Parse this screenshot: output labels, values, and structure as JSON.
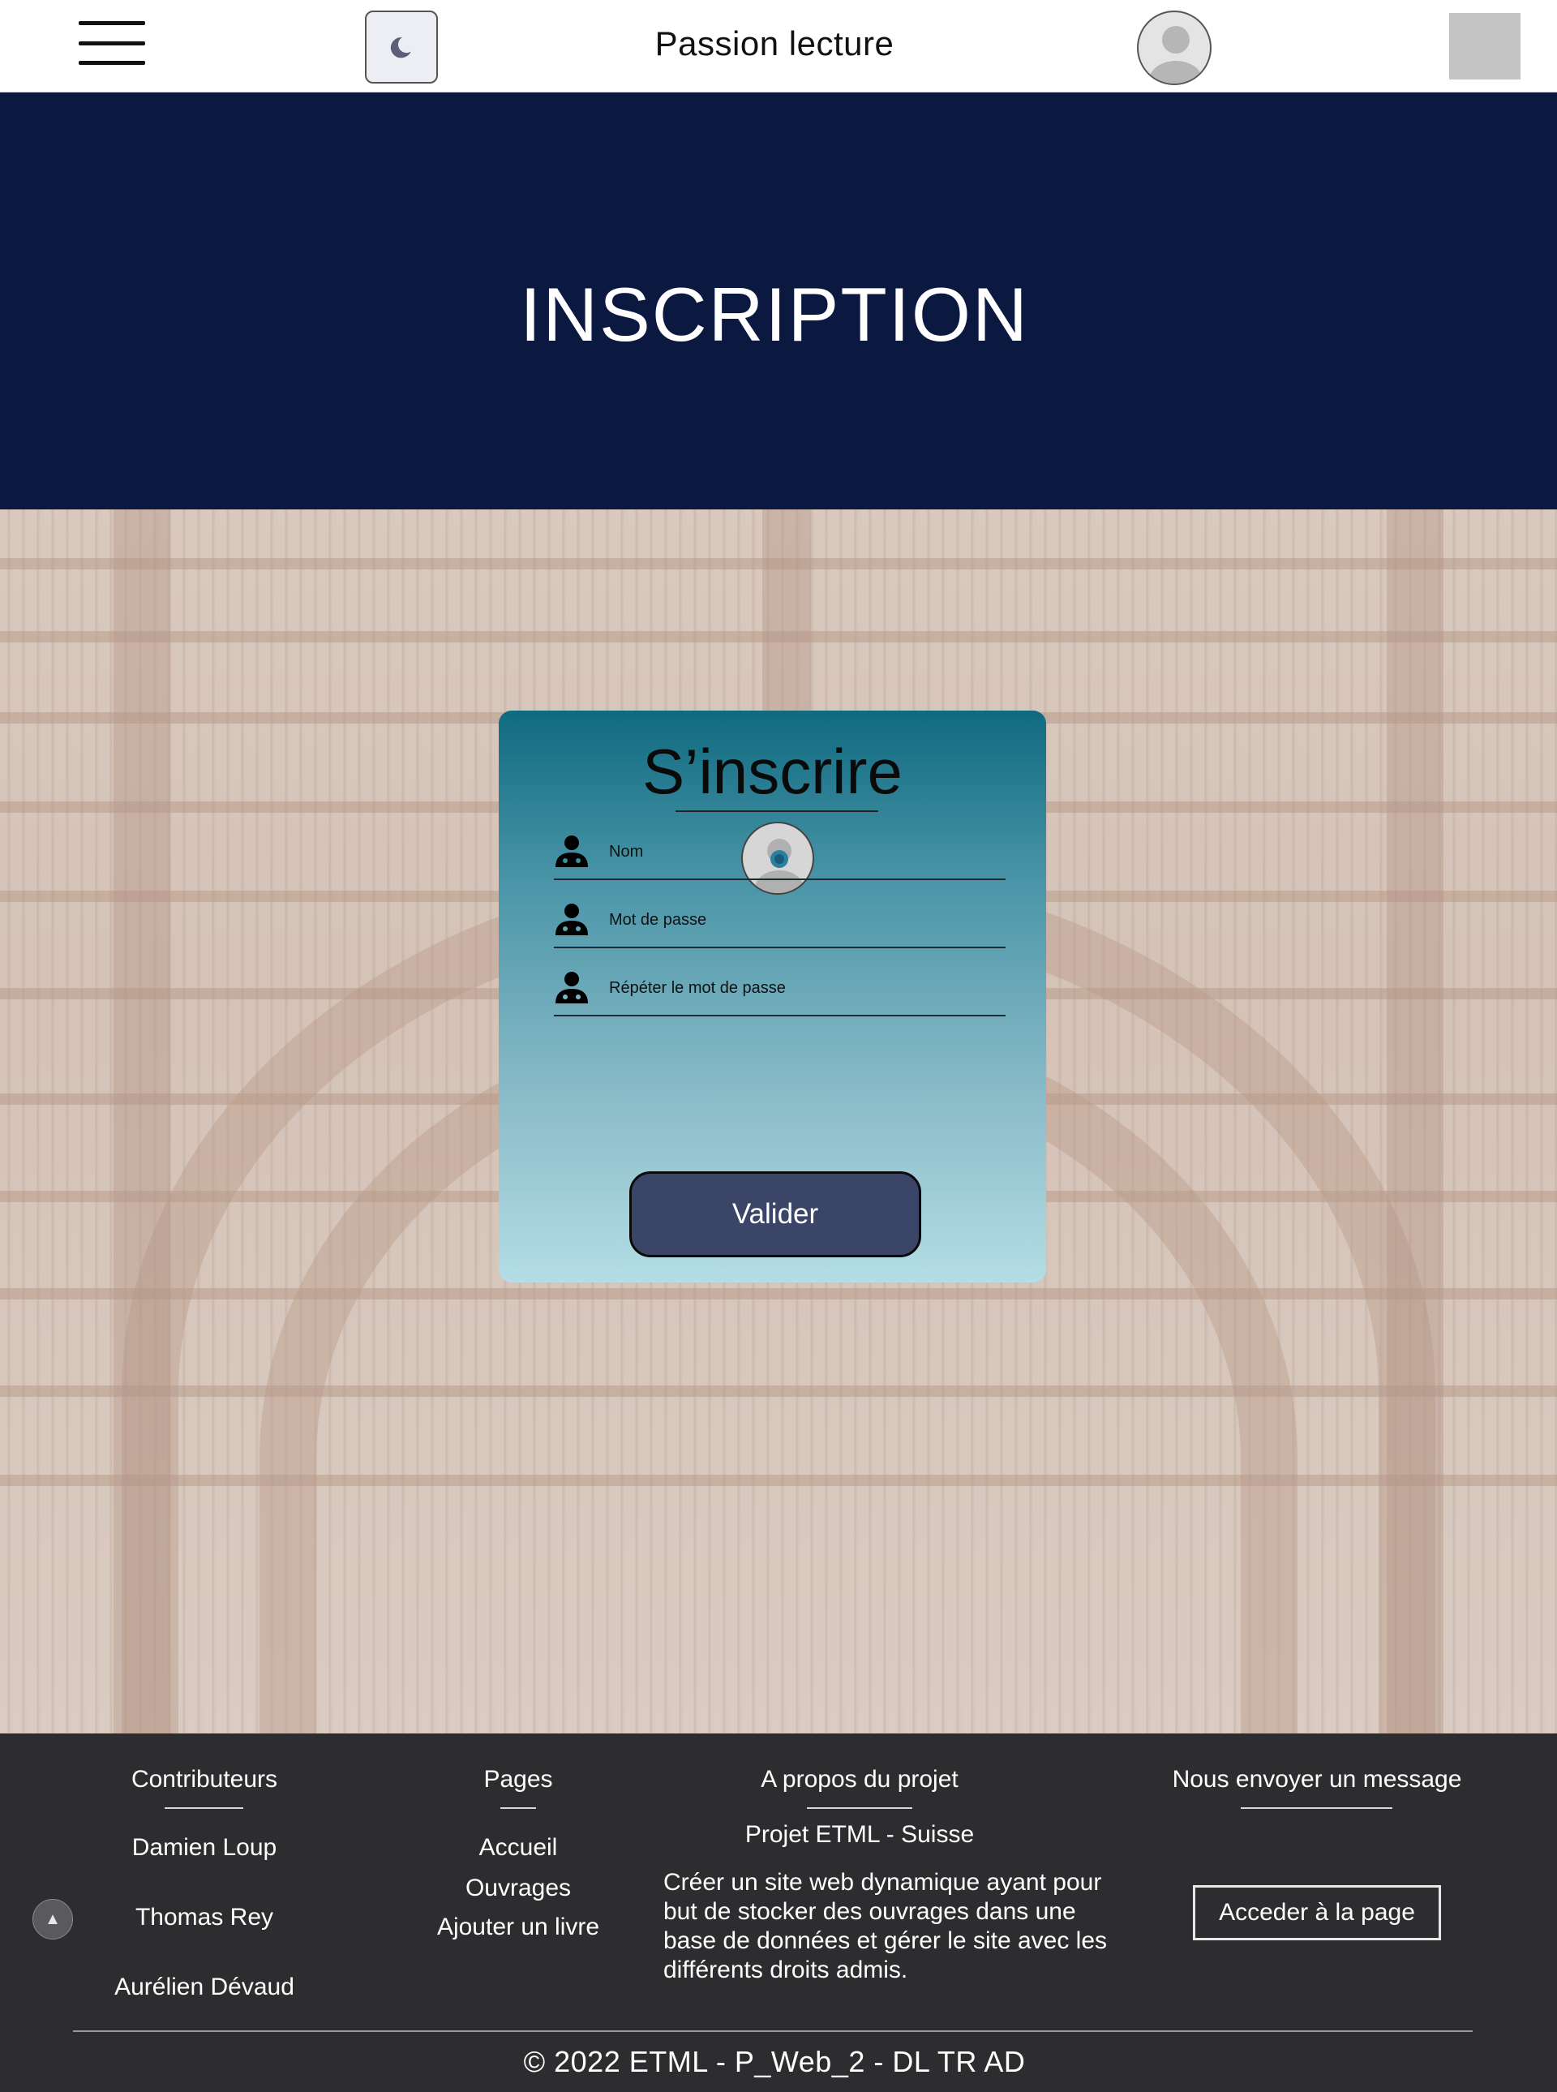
{
  "header": {
    "site_title": "Passion lecture",
    "menu_icon": "hamburger-menu-icon",
    "theme_icon": "moon-icon",
    "profile_icon": "user-avatar-icon"
  },
  "banner": {
    "title": "INSCRIPTION",
    "background_color": "#0b1840"
  },
  "form": {
    "title": "S’inscrire",
    "avatar_icon": "user-avatar-icon",
    "fields": [
      {
        "icon": "user-icon",
        "placeholder": "Nom",
        "value": ""
      },
      {
        "icon": "user-icon",
        "placeholder": "Mot de passe",
        "value": ""
      },
      {
        "icon": "user-icon",
        "placeholder": "Répéter le mot de passe",
        "value": ""
      }
    ],
    "submit_label": "Valider",
    "submit_color": "#3a4567"
  },
  "footer": {
    "contributors": {
      "heading": "Contributeurs",
      "names": [
        "Damien Loup",
        "Thomas Rey",
        "Aurélien Dévaud"
      ]
    },
    "pages": {
      "heading": "Pages",
      "links": [
        "Accueil",
        "Ouvrages",
        "Ajouter un livre"
      ]
    },
    "about": {
      "heading": "A propos du projet",
      "subtitle": "Projet ETML - Suisse",
      "description": "Créer un site web dynamique ayant pour but de stocker des ouvrages dans une base de données et gérer le site avec les différents droits admis."
    },
    "contact": {
      "heading": "Nous envoyer un message",
      "button_label": "Acceder à la page"
    },
    "back_to_top_icon": "arrow-up-icon",
    "copyright": "© 2022 ETML - P_Web_2 - DL TR AD",
    "background_color": "#2d2d30"
  }
}
